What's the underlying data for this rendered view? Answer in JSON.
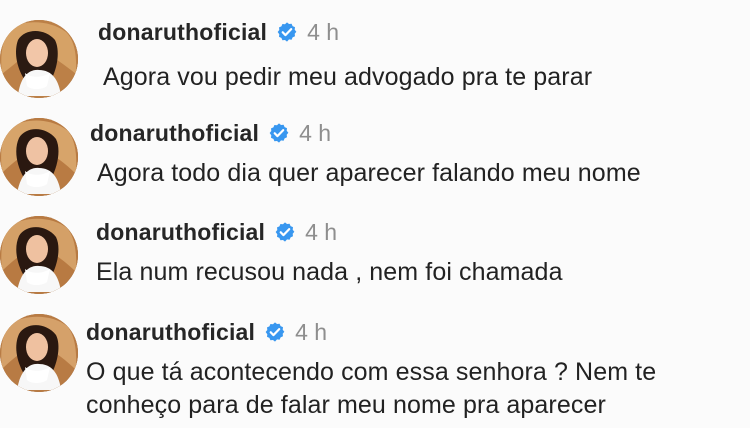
{
  "comments": [
    {
      "username": "donaruthoficial",
      "time": "4 h",
      "text": "Agora vou pedir meu advogado pra te parar",
      "avatar_icon": "profile-photo"
    },
    {
      "username": "donaruthoficial",
      "time": "4 h",
      "text": "Agora todo dia quer aparecer falando meu nome",
      "avatar_icon": "profile-photo"
    },
    {
      "username": "donaruthoficial",
      "time": "4 h",
      "text": "Ela num recusou nada , nem foi chamada",
      "avatar_icon": "profile-photo"
    },
    {
      "username": "donaruthoficial",
      "time": "4 h",
      "text": "O que tá acontecendo com essa senhora ? Nem te conheço para de falar meu nome pra aparecer",
      "avatar_icon": "profile-photo"
    }
  ],
  "colors": {
    "verified_blue": "#3897f0",
    "username": "#262626",
    "time_gray": "#8e8e8e"
  }
}
